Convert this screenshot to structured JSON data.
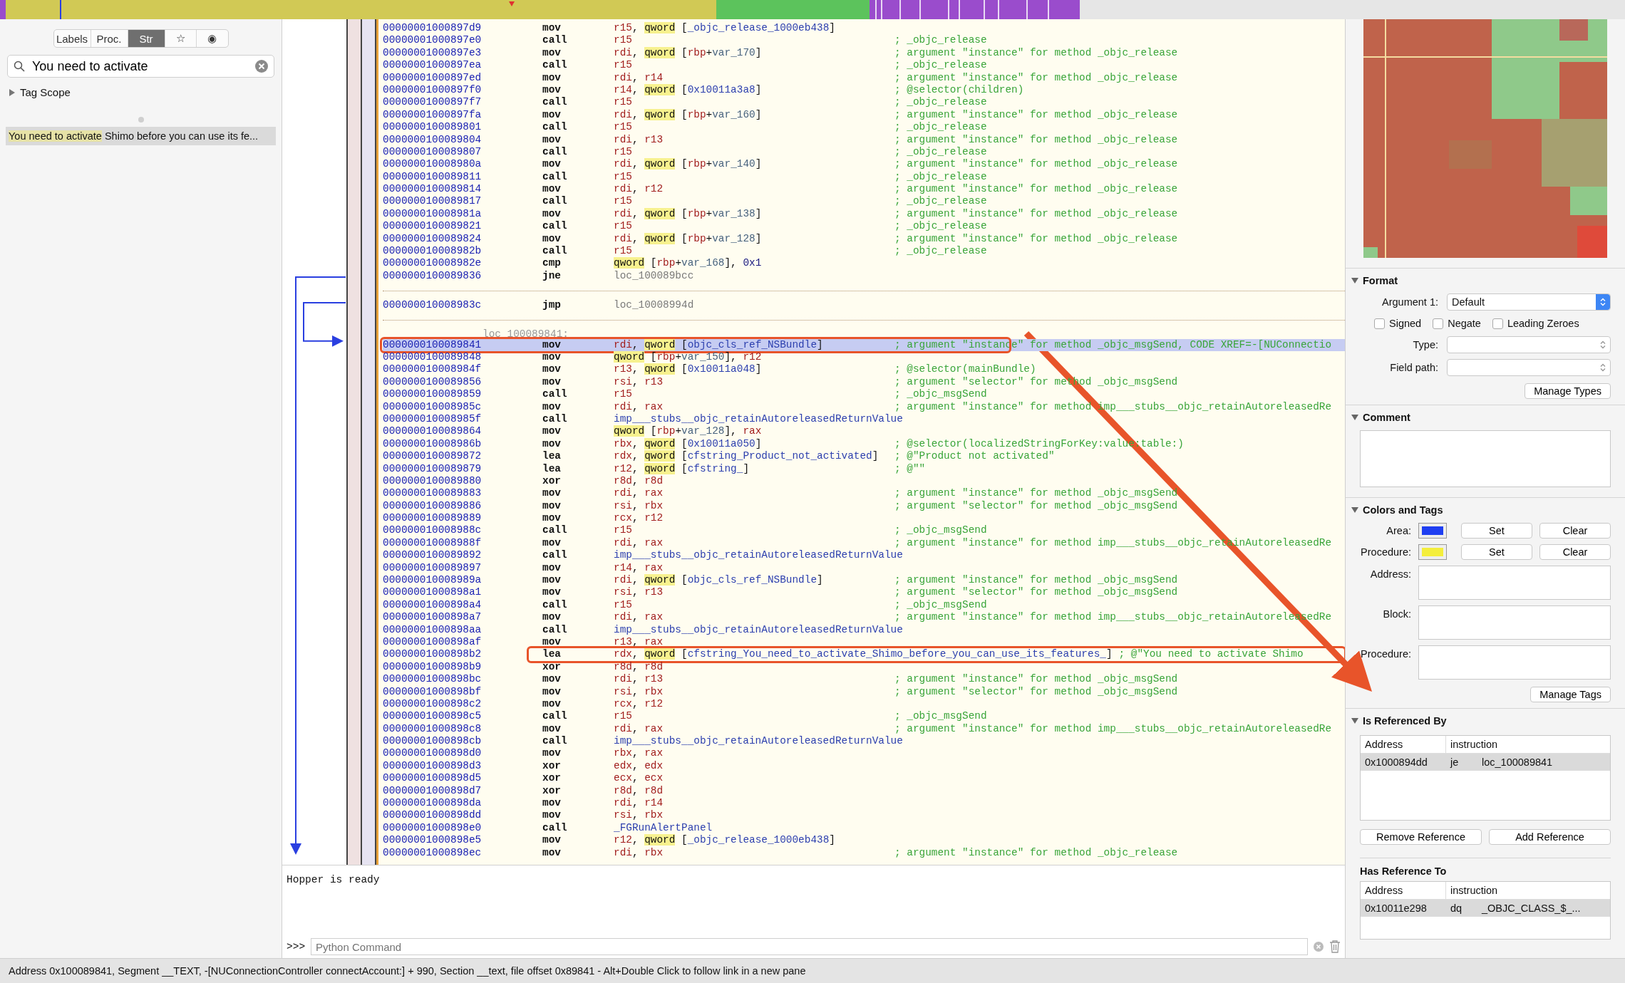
{
  "sidebar": {
    "tabs": [
      {
        "kind": "text",
        "label": "Labels",
        "selected": false
      },
      {
        "kind": "text",
        "label": "Proc.",
        "selected": false
      },
      {
        "kind": "text",
        "label": "Str",
        "selected": true
      },
      {
        "kind": "glyph",
        "label": "☆",
        "selected": false
      },
      {
        "kind": "glyph",
        "label": "◉",
        "selected": false
      }
    ],
    "search": {
      "value": "You need to activate"
    },
    "tag_scope": {
      "label": "Tag Scope",
      "expanded": false
    },
    "results": [
      {
        "match": "You need to activate",
        "rest": " Shimo before you can use its fe...",
        "selected": true
      }
    ]
  },
  "code": {
    "rows": [
      {
        "kind": "instruction",
        "selected": false,
        "address": "00000001000897d9",
        "mnemonic": "mov",
        "operands": [
          {
            "kind": "reg",
            "text": "r15"
          },
          {
            "kind": "plain",
            "text": ", "
          },
          {
            "kind": "size",
            "text": "qword"
          },
          {
            "kind": "plain",
            "text": " ["
          },
          {
            "kind": "sym",
            "text": "_objc_release_1000eb438"
          },
          {
            "kind": "plain",
            "text": "]"
          }
        ]
      },
      {
        "kind": "instruction",
        "selected": false,
        "address": "00000001000897e0",
        "mnemonic": "call",
        "operands": [
          {
            "kind": "reg",
            "text": "r15"
          }
        ],
        "comment": "; _objc_release"
      },
      {
        "kind": "instruction",
        "selected": false,
        "address": "00000001000897e3",
        "mnemonic": "mov",
        "operands": [
          {
            "kind": "reg",
            "text": "rdi"
          },
          {
            "kind": "plain",
            "text": ", "
          },
          {
            "kind": "size",
            "text": "qword"
          },
          {
            "kind": "plain",
            "text": " ["
          },
          {
            "kind": "reg",
            "text": "rbp"
          },
          {
            "kind": "plain",
            "text": "+"
          },
          {
            "kind": "var",
            "text": "var_170"
          },
          {
            "kind": "plain",
            "text": "]"
          }
        ],
        "comment": "; argument \"instance\" for method _objc_release"
      },
      {
        "kind": "instruction",
        "selected": false,
        "address": "00000001000897ea",
        "mnemonic": "call",
        "operands": [
          {
            "kind": "reg",
            "text": "r15"
          }
        ],
        "comment": "; _objc_release"
      },
      {
        "kind": "instruction",
        "selected": false,
        "address": "00000001000897ed",
        "mnemonic": "mov",
        "operands": [
          {
            "kind": "reg",
            "text": "rdi"
          },
          {
            "kind": "plain",
            "text": ", "
          },
          {
            "kind": "reg",
            "text": "r14"
          }
        ],
        "comment": "; argument \"instance\" for method _objc_release"
      },
      {
        "kind": "instruction",
        "selected": false,
        "address": "00000001000897f0",
        "mnemonic": "mov",
        "operands": [
          {
            "kind": "reg",
            "text": "r14"
          },
          {
            "kind": "plain",
            "text": ", "
          },
          {
            "kind": "size",
            "text": "qword"
          },
          {
            "kind": "plain",
            "text": " ["
          },
          {
            "kind": "sym",
            "text": "0x10011a3a8"
          },
          {
            "kind": "plain",
            "text": "]"
          }
        ],
        "comment": "; @selector(children)"
      },
      {
        "kind": "instruction",
        "selected": false,
        "address": "00000001000897f7",
        "mnemonic": "call",
        "operands": [
          {
            "kind": "reg",
            "text": "r15"
          }
        ],
        "comment": "; _objc_release"
      },
      {
        "kind": "instruction",
        "selected": false,
        "address": "00000001000897fa",
        "mnemonic": "mov",
        "operands": [
          {
            "kind": "reg",
            "text": "rdi"
          },
          {
            "kind": "plain",
            "text": ", "
          },
          {
            "kind": "size",
            "text": "qword"
          },
          {
            "kind": "plain",
            "text": " ["
          },
          {
            "kind": "reg",
            "text": "rbp"
          },
          {
            "kind": "plain",
            "text": "+"
          },
          {
            "kind": "var",
            "text": "var_160"
          },
          {
            "kind": "plain",
            "text": "]"
          }
        ],
        "comment": "; argument \"instance\" for method _objc_release"
      },
      {
        "kind": "instruction",
        "selected": false,
        "address": "0000000100089801",
        "mnemonic": "call",
        "operands": [
          {
            "kind": "reg",
            "text": "r15"
          }
        ],
        "comment": "; _objc_release"
      },
      {
        "kind": "instruction",
        "selected": false,
        "address": "0000000100089804",
        "mnemonic": "mov",
        "operands": [
          {
            "kind": "reg",
            "text": "rdi"
          },
          {
            "kind": "plain",
            "text": ", "
          },
          {
            "kind": "reg",
            "text": "r13"
          }
        ],
        "comment": "; argument \"instance\" for method _objc_release"
      },
      {
        "kind": "instruction",
        "selected": false,
        "address": "0000000100089807",
        "mnemonic": "call",
        "operands": [
          {
            "kind": "reg",
            "text": "r15"
          }
        ],
        "comment": "; _objc_release"
      },
      {
        "kind": "instruction",
        "selected": false,
        "address": "000000010008980a",
        "mnemonic": "mov",
        "operands": [
          {
            "kind": "reg",
            "text": "rdi"
          },
          {
            "kind": "plain",
            "text": ", "
          },
          {
            "kind": "size",
            "text": "qword"
          },
          {
            "kind": "plain",
            "text": " ["
          },
          {
            "kind": "reg",
            "text": "rbp"
          },
          {
            "kind": "plain",
            "text": "+"
          },
          {
            "kind": "var",
            "text": "var_140"
          },
          {
            "kind": "plain",
            "text": "]"
          }
        ],
        "comment": "; argument \"instance\" for method _objc_release"
      },
      {
        "kind": "instruction",
        "selected": false,
        "address": "0000000100089811",
        "mnemonic": "call",
        "operands": [
          {
            "kind": "reg",
            "text": "r15"
          }
        ],
        "comment": "; _objc_release"
      },
      {
        "kind": "instruction",
        "selected": false,
        "address": "0000000100089814",
        "mnemonic": "mov",
        "operands": [
          {
            "kind": "reg",
            "text": "rdi"
          },
          {
            "kind": "plain",
            "text": ", "
          },
          {
            "kind": "reg",
            "text": "r12"
          }
        ],
        "comment": "; argument \"instance\" for method _objc_release"
      },
      {
        "kind": "instruction",
        "selected": false,
        "address": "0000000100089817",
        "mnemonic": "call",
        "operands": [
          {
            "kind": "reg",
            "text": "r15"
          }
        ],
        "comment": "; _objc_release"
      },
      {
        "kind": "instruction",
        "selected": false,
        "address": "000000010008981a",
        "mnemonic": "mov",
        "operands": [
          {
            "kind": "reg",
            "text": "rdi"
          },
          {
            "kind": "plain",
            "text": ", "
          },
          {
            "kind": "size",
            "text": "qword"
          },
          {
            "kind": "plain",
            "text": " ["
          },
          {
            "kind": "reg",
            "text": "rbp"
          },
          {
            "kind": "plain",
            "text": "+"
          },
          {
            "kind": "var",
            "text": "var_138"
          },
          {
            "kind": "plain",
            "text": "]"
          }
        ],
        "comment": "; argument \"instance\" for method _objc_release"
      },
      {
        "kind": "instruction",
        "selected": false,
        "address": "0000000100089821",
        "mnemonic": "call",
        "operands": [
          {
            "kind": "reg",
            "text": "r15"
          }
        ],
        "comment": "; _objc_release"
      },
      {
        "kind": "instruction",
        "selected": false,
        "address": "0000000100089824",
        "mnemonic": "mov",
        "operands": [
          {
            "kind": "reg",
            "text": "rdi"
          },
          {
            "kind": "plain",
            "text": ", "
          },
          {
            "kind": "size",
            "text": "qword"
          },
          {
            "kind": "plain",
            "text": " ["
          },
          {
            "kind": "reg",
            "text": "rbp"
          },
          {
            "kind": "plain",
            "text": "+"
          },
          {
            "kind": "var",
            "text": "var_128"
          },
          {
            "kind": "plain",
            "text": "]"
          }
        ],
        "comment": "; argument \"instance\" for method _objc_release"
      },
      {
        "kind": "instruction",
        "selected": false,
        "address": "000000010008982b",
        "mnemonic": "call",
        "operands": [
          {
            "kind": "reg",
            "text": "r15"
          }
        ],
        "comment": "; _objc_release"
      },
      {
        "kind": "instruction",
        "selected": false,
        "address": "000000010008982e",
        "mnemonic": "cmp",
        "operands": [
          {
            "kind": "size",
            "text": "qword"
          },
          {
            "kind": "plain",
            "text": " ["
          },
          {
            "kind": "reg",
            "text": "rbp"
          },
          {
            "kind": "plain",
            "text": "+"
          },
          {
            "kind": "var",
            "text": "var_168"
          },
          {
            "kind": "plain",
            "text": "], "
          },
          {
            "kind": "num",
            "text": "0x1"
          }
        ]
      },
      {
        "kind": "instruction",
        "selected": false,
        "address": "0000000100089836",
        "mnemonic": "jne",
        "operands": [
          {
            "kind": "loc",
            "text": "loc_100089bcc"
          }
        ]
      },
      {
        "kind": "separator"
      },
      {
        "kind": "instruction",
        "selected": false,
        "address": "000000010008983c",
        "mnemonic": "jmp",
        "operands": [
          {
            "kind": "loc",
            "text": "loc_10008994d"
          }
        ]
      },
      {
        "kind": "separator"
      },
      {
        "kind": "label",
        "text": "loc_100089841:"
      },
      {
        "kind": "instruction",
        "selected": true,
        "annotation": {
          "kind": "box-from-address"
        },
        "address": "0000000100089841",
        "mnemonic": "mov",
        "operands": [
          {
            "kind": "reg",
            "text": "rdi"
          },
          {
            "kind": "plain",
            "text": ", "
          },
          {
            "kind": "size",
            "text": "qword"
          },
          {
            "kind": "plain",
            "text": " ["
          },
          {
            "kind": "sym",
            "text": "objc_cls_ref_NSBundle"
          },
          {
            "kind": "plain",
            "text": "]"
          }
        ],
        "comment": "; argument \"instance\" for method _objc_msgSend, CODE XREF=-[NUConnectio"
      },
      {
        "kind": "instruction",
        "selected": false,
        "address": "0000000100089848",
        "mnemonic": "mov",
        "operands": [
          {
            "kind": "size",
            "text": "qword"
          },
          {
            "kind": "plain",
            "text": " ["
          },
          {
            "kind": "reg",
            "text": "rbp"
          },
          {
            "kind": "plain",
            "text": "+"
          },
          {
            "kind": "var",
            "text": "var_150"
          },
          {
            "kind": "plain",
            "text": "], "
          },
          {
            "kind": "reg",
            "text": "r12"
          }
        ]
      },
      {
        "kind": "instruction",
        "selected": false,
        "address": "000000010008984f",
        "mnemonic": "mov",
        "operands": [
          {
            "kind": "reg",
            "text": "r13"
          },
          {
            "kind": "plain",
            "text": ", "
          },
          {
            "kind": "size",
            "text": "qword"
          },
          {
            "kind": "plain",
            "text": " ["
          },
          {
            "kind": "sym",
            "text": "0x10011a048"
          },
          {
            "kind": "plain",
            "text": "]"
          }
        ],
        "comment": "; @selector(mainBundle)"
      },
      {
        "kind": "instruction",
        "selected": false,
        "address": "0000000100089856",
        "mnemonic": "mov",
        "operands": [
          {
            "kind": "reg",
            "text": "rsi"
          },
          {
            "kind": "plain",
            "text": ", "
          },
          {
            "kind": "reg",
            "text": "r13"
          }
        ],
        "comment": "; argument \"selector\" for method _objc_msgSend"
      },
      {
        "kind": "instruction",
        "selected": false,
        "address": "0000000100089859",
        "mnemonic": "call",
        "operands": [
          {
            "kind": "reg",
            "text": "r15"
          }
        ],
        "comment": "; _objc_msgSend"
      },
      {
        "kind": "instruction",
        "selected": false,
        "address": "000000010008985c",
        "mnemonic": "mov",
        "operands": [
          {
            "kind": "reg",
            "text": "rdi"
          },
          {
            "kind": "plain",
            "text": ", "
          },
          {
            "kind": "reg",
            "text": "rax"
          }
        ],
        "comment": "; argument \"instance\" for method imp___stubs__objc_retainAutoreleasedRe"
      },
      {
        "kind": "instruction",
        "selected": false,
        "address": "000000010008985f",
        "mnemonic": "call",
        "operands": [
          {
            "kind": "sym",
            "text": "imp___stubs__objc_retainAutoreleasedReturnValue"
          }
        ]
      },
      {
        "kind": "instruction",
        "selected": false,
        "address": "0000000100089864",
        "mnemonic": "mov",
        "operands": [
          {
            "kind": "size",
            "text": "qword"
          },
          {
            "kind": "plain",
            "text": " ["
          },
          {
            "kind": "reg",
            "text": "rbp"
          },
          {
            "kind": "plain",
            "text": "+"
          },
          {
            "kind": "var",
            "text": "var_128"
          },
          {
            "kind": "plain",
            "text": "], "
          },
          {
            "kind": "reg",
            "text": "rax"
          }
        ]
      },
      {
        "kind": "instruction",
        "selected": false,
        "address": "000000010008986b",
        "mnemonic": "mov",
        "operands": [
          {
            "kind": "reg",
            "text": "rbx"
          },
          {
            "kind": "plain",
            "text": ", "
          },
          {
            "kind": "size",
            "text": "qword"
          },
          {
            "kind": "plain",
            "text": " ["
          },
          {
            "kind": "sym",
            "text": "0x10011a050"
          },
          {
            "kind": "plain",
            "text": "]"
          }
        ],
        "comment": "; @selector(localizedStringForKey:value:table:)"
      },
      {
        "kind": "instruction",
        "selected": false,
        "address": "0000000100089872",
        "mnemonic": "lea",
        "operands": [
          {
            "kind": "reg",
            "text": "rdx"
          },
          {
            "kind": "plain",
            "text": ", "
          },
          {
            "kind": "size",
            "text": "qword"
          },
          {
            "kind": "plain",
            "text": " ["
          },
          {
            "kind": "sym",
            "text": "cfstring_Product_not_activated"
          },
          {
            "kind": "plain",
            "text": "]"
          }
        ],
        "comment": "; @\"Product not activated\""
      },
      {
        "kind": "instruction",
        "selected": false,
        "address": "0000000100089879",
        "mnemonic": "lea",
        "operands": [
          {
            "kind": "reg",
            "text": "r12"
          },
          {
            "kind": "plain",
            "text": ", "
          },
          {
            "kind": "size",
            "text": "qword"
          },
          {
            "kind": "plain",
            "text": " ["
          },
          {
            "kind": "sym",
            "text": "cfstring_"
          },
          {
            "kind": "plain",
            "text": "]"
          }
        ],
        "comment": "; @\"\""
      },
      {
        "kind": "instruction",
        "selected": false,
        "address": "0000000100089880",
        "mnemonic": "xor",
        "operands": [
          {
            "kind": "reg",
            "text": "r8d"
          },
          {
            "kind": "plain",
            "text": ", "
          },
          {
            "kind": "reg",
            "text": "r8d"
          }
        ]
      },
      {
        "kind": "instruction",
        "selected": false,
        "address": "0000000100089883",
        "mnemonic": "mov",
        "operands": [
          {
            "kind": "reg",
            "text": "rdi"
          },
          {
            "kind": "plain",
            "text": ", "
          },
          {
            "kind": "reg",
            "text": "rax"
          }
        ],
        "comment": "; argument \"instance\" for method _objc_msgSend"
      },
      {
        "kind": "instruction",
        "selected": false,
        "address": "0000000100089886",
        "mnemonic": "mov",
        "operands": [
          {
            "kind": "reg",
            "text": "rsi"
          },
          {
            "kind": "plain",
            "text": ", "
          },
          {
            "kind": "reg",
            "text": "rbx"
          }
        ],
        "comment": "; argument \"selector\" for method _objc_msgSend"
      },
      {
        "kind": "instruction",
        "selected": false,
        "address": "0000000100089889",
        "mnemonic": "mov",
        "operands": [
          {
            "kind": "reg",
            "text": "rcx"
          },
          {
            "kind": "plain",
            "text": ", "
          },
          {
            "kind": "reg",
            "text": "r12"
          }
        ]
      },
      {
        "kind": "instruction",
        "selected": false,
        "address": "000000010008988c",
        "mnemonic": "call",
        "operands": [
          {
            "kind": "reg",
            "text": "r15"
          }
        ],
        "comment": "; _objc_msgSend"
      },
      {
        "kind": "instruction",
        "selected": false,
        "address": "000000010008988f",
        "mnemonic": "mov",
        "operands": [
          {
            "kind": "reg",
            "text": "rdi"
          },
          {
            "kind": "plain",
            "text": ", "
          },
          {
            "kind": "reg",
            "text": "rax"
          }
        ],
        "comment": "; argument \"instance\" for method imp___stubs__objc_retainAutoreleasedRe"
      },
      {
        "kind": "instruction",
        "selected": false,
        "address": "0000000100089892",
        "mnemonic": "call",
        "operands": [
          {
            "kind": "sym",
            "text": "imp___stubs__objc_retainAutoreleasedReturnValue"
          }
        ]
      },
      {
        "kind": "instruction",
        "selected": false,
        "address": "0000000100089897",
        "mnemonic": "mov",
        "operands": [
          {
            "kind": "reg",
            "text": "r14"
          },
          {
            "kind": "plain",
            "text": ", "
          },
          {
            "kind": "reg",
            "text": "rax"
          }
        ]
      },
      {
        "kind": "instruction",
        "selected": false,
        "address": "000000010008989a",
        "mnemonic": "mov",
        "operands": [
          {
            "kind": "reg",
            "text": "rdi"
          },
          {
            "kind": "plain",
            "text": ", "
          },
          {
            "kind": "size",
            "text": "qword"
          },
          {
            "kind": "plain",
            "text": " ["
          },
          {
            "kind": "sym",
            "text": "objc_cls_ref_NSBundle"
          },
          {
            "kind": "plain",
            "text": "]"
          }
        ],
        "comment": "; argument \"instance\" for method _objc_msgSend"
      },
      {
        "kind": "instruction",
        "selected": false,
        "address": "00000001000898a1",
        "mnemonic": "mov",
        "operands": [
          {
            "kind": "reg",
            "text": "rsi"
          },
          {
            "kind": "plain",
            "text": ", "
          },
          {
            "kind": "reg",
            "text": "r13"
          }
        ],
        "comment": "; argument \"selector\" for method _objc_msgSend"
      },
      {
        "kind": "instruction",
        "selected": false,
        "address": "00000001000898a4",
        "mnemonic": "call",
        "operands": [
          {
            "kind": "reg",
            "text": "r15"
          }
        ],
        "comment": "; _objc_msgSend"
      },
      {
        "kind": "instruction",
        "selected": false,
        "address": "00000001000898a7",
        "mnemonic": "mov",
        "operands": [
          {
            "kind": "reg",
            "text": "rdi"
          },
          {
            "kind": "plain",
            "text": ", "
          },
          {
            "kind": "reg",
            "text": "rax"
          }
        ],
        "comment": "; argument \"instance\" for method imp___stubs__objc_retainAutoreleasedRe"
      },
      {
        "kind": "instruction",
        "selected": false,
        "address": "00000001000898aa",
        "mnemonic": "call",
        "operands": [
          {
            "kind": "sym",
            "text": "imp___stubs__objc_retainAutoreleasedReturnValue"
          }
        ]
      },
      {
        "kind": "instruction",
        "selected": false,
        "address": "00000001000898af",
        "mnemonic": "mov",
        "operands": [
          {
            "kind": "reg",
            "text": "r13"
          },
          {
            "kind": "plain",
            "text": ", "
          },
          {
            "kind": "reg",
            "text": "rax"
          }
        ]
      },
      {
        "kind": "instruction",
        "selected": false,
        "annotation": {
          "kind": "box-from-mnemonic"
        },
        "address": "00000001000898b2",
        "mnemonic": "lea",
        "operands": [
          {
            "kind": "reg",
            "text": "rdx"
          },
          {
            "kind": "plain",
            "text": ", "
          },
          {
            "kind": "size",
            "text": "qword"
          },
          {
            "kind": "plain",
            "text": " ["
          },
          {
            "kind": "sym",
            "text": "cfstring_You_need_to_activate_Shimo_before_you_can_use_its_features_"
          },
          {
            "kind": "plain",
            "text": "]"
          }
        ],
        "comment": "; @\"You need to activate Shimo"
      },
      {
        "kind": "instruction",
        "selected": false,
        "address": "00000001000898b9",
        "mnemonic": "xor",
        "operands": [
          {
            "kind": "reg",
            "text": "r8d"
          },
          {
            "kind": "plain",
            "text": ", "
          },
          {
            "kind": "reg",
            "text": "r8d"
          }
        ]
      },
      {
        "kind": "instruction",
        "selected": false,
        "address": "00000001000898bc",
        "mnemonic": "mov",
        "operands": [
          {
            "kind": "reg",
            "text": "rdi"
          },
          {
            "kind": "plain",
            "text": ", "
          },
          {
            "kind": "reg",
            "text": "r13"
          }
        ],
        "comment": "; argument \"instance\" for method _objc_msgSend"
      },
      {
        "kind": "instruction",
        "selected": false,
        "address": "00000001000898bf",
        "mnemonic": "mov",
        "operands": [
          {
            "kind": "reg",
            "text": "rsi"
          },
          {
            "kind": "plain",
            "text": ", "
          },
          {
            "kind": "reg",
            "text": "rbx"
          }
        ],
        "comment": "; argument \"selector\" for method _objc_msgSend"
      },
      {
        "kind": "instruction",
        "selected": false,
        "address": "00000001000898c2",
        "mnemonic": "mov",
        "operands": [
          {
            "kind": "reg",
            "text": "rcx"
          },
          {
            "kind": "plain",
            "text": ", "
          },
          {
            "kind": "reg",
            "text": "r12"
          }
        ]
      },
      {
        "kind": "instruction",
        "selected": false,
        "address": "00000001000898c5",
        "mnemonic": "call",
        "operands": [
          {
            "kind": "reg",
            "text": "r15"
          }
        ],
        "comment": "; _objc_msgSend"
      },
      {
        "kind": "instruction",
        "selected": false,
        "address": "00000001000898c8",
        "mnemonic": "mov",
        "operands": [
          {
            "kind": "reg",
            "text": "rdi"
          },
          {
            "kind": "plain",
            "text": ", "
          },
          {
            "kind": "reg",
            "text": "rax"
          }
        ],
        "comment": "; argument \"instance\" for method imp___stubs__objc_retainAutoreleasedRe"
      },
      {
        "kind": "instruction",
        "selected": false,
        "address": "00000001000898cb",
        "mnemonic": "call",
        "operands": [
          {
            "kind": "sym",
            "text": "imp___stubs__objc_retainAutoreleasedReturnValue"
          }
        ]
      },
      {
        "kind": "instruction",
        "selected": false,
        "address": "00000001000898d0",
        "mnemonic": "mov",
        "operands": [
          {
            "kind": "reg",
            "text": "rbx"
          },
          {
            "kind": "plain",
            "text": ", "
          },
          {
            "kind": "reg",
            "text": "rax"
          }
        ]
      },
      {
        "kind": "instruction",
        "selected": false,
        "address": "00000001000898d3",
        "mnemonic": "xor",
        "operands": [
          {
            "kind": "reg",
            "text": "edx"
          },
          {
            "kind": "plain",
            "text": ", "
          },
          {
            "kind": "reg",
            "text": "edx"
          }
        ]
      },
      {
        "kind": "instruction",
        "selected": false,
        "address": "00000001000898d5",
        "mnemonic": "xor",
        "operands": [
          {
            "kind": "reg",
            "text": "ecx"
          },
          {
            "kind": "plain",
            "text": ", "
          },
          {
            "kind": "reg",
            "text": "ecx"
          }
        ]
      },
      {
        "kind": "instruction",
        "selected": false,
        "address": "00000001000898d7",
        "mnemonic": "xor",
        "operands": [
          {
            "kind": "reg",
            "text": "r8d"
          },
          {
            "kind": "plain",
            "text": ", "
          },
          {
            "kind": "reg",
            "text": "r8d"
          }
        ]
      },
      {
        "kind": "instruction",
        "selected": false,
        "address": "00000001000898da",
        "mnemonic": "mov",
        "operands": [
          {
            "kind": "reg",
            "text": "rdi"
          },
          {
            "kind": "plain",
            "text": ", "
          },
          {
            "kind": "reg",
            "text": "r14"
          }
        ]
      },
      {
        "kind": "instruction",
        "selected": false,
        "address": "00000001000898dd",
        "mnemonic": "mov",
        "operands": [
          {
            "kind": "reg",
            "text": "rsi"
          },
          {
            "kind": "plain",
            "text": ", "
          },
          {
            "kind": "reg",
            "text": "rbx"
          }
        ]
      },
      {
        "kind": "instruction",
        "selected": false,
        "address": "00000001000898e0",
        "mnemonic": "call",
        "operands": [
          {
            "kind": "sym",
            "text": "_FGRunAlertPanel"
          }
        ]
      },
      {
        "kind": "instruction",
        "selected": false,
        "address": "00000001000898e5",
        "mnemonic": "mov",
        "operands": [
          {
            "kind": "reg",
            "text": "r12"
          },
          {
            "kind": "plain",
            "text": ", "
          },
          {
            "kind": "size",
            "text": "qword"
          },
          {
            "kind": "plain",
            "text": " ["
          },
          {
            "kind": "sym",
            "text": "_objc_release_1000eb438"
          },
          {
            "kind": "plain",
            "text": "]"
          }
        ]
      },
      {
        "kind": "instruction",
        "selected": false,
        "address": "00000001000898ec",
        "mnemonic": "mov",
        "operands": [
          {
            "kind": "reg",
            "text": "rdi"
          },
          {
            "kind": "plain",
            "text": ", "
          },
          {
            "kind": "reg",
            "text": "rbx"
          }
        ],
        "comment": "; argument \"instance\" for method _objc_release"
      }
    ]
  },
  "console": {
    "output": "Hopper is ready",
    "prompt": ">>>",
    "placeholder": "Python Command"
  },
  "inspector": {
    "format": {
      "title": "Format",
      "argument_label": "Argument 1:",
      "argument_value": "Default",
      "checkboxes": [
        {
          "label": "Signed",
          "checked": false
        },
        {
          "label": "Negate",
          "checked": false
        },
        {
          "label": "Leading Zeroes",
          "checked": false
        }
      ],
      "selects": [
        {
          "label": "Type:",
          "disabled": true
        },
        {
          "label": "Field path:",
          "disabled": true
        }
      ],
      "button": "Manage Types"
    },
    "comment": {
      "title": "Comment"
    },
    "colors": {
      "title": "Colors and Tags",
      "swatches": [
        {
          "label": "Area:",
          "color": "#1f3ff2",
          "set": "Set",
          "clear": "Clear"
        },
        {
          "label": "Procedure:",
          "color": "#f4ee3c",
          "set": "Set",
          "clear": "Clear"
        }
      ],
      "fields": [
        "Address:",
        "Block:",
        "Procedure:"
      ],
      "button": "Manage Tags"
    },
    "referenced_by": {
      "title": "Is Referenced By",
      "columns": [
        "Address",
        "instruction"
      ],
      "rows": [
        {
          "address": "0x1000894dd",
          "op": "je",
          "target": "loc_100089841",
          "selected": true
        }
      ],
      "buttons": [
        "Remove Reference",
        "Add Reference"
      ]
    },
    "reference_to": {
      "title": "Has Reference To",
      "columns": [
        "Address",
        "instruction"
      ],
      "rows": [
        {
          "address": "0x10011e298",
          "op": "dq",
          "target": "_OBJC_CLASS_$_...",
          "selected": true
        }
      ]
    }
  },
  "status_bar": "Address 0x100089841, Segment __TEXT, -[NUConnectionController connectAccount:] + 990, Section __text, file offset 0x89841 - Alt+Double Click to follow link in a new pane"
}
